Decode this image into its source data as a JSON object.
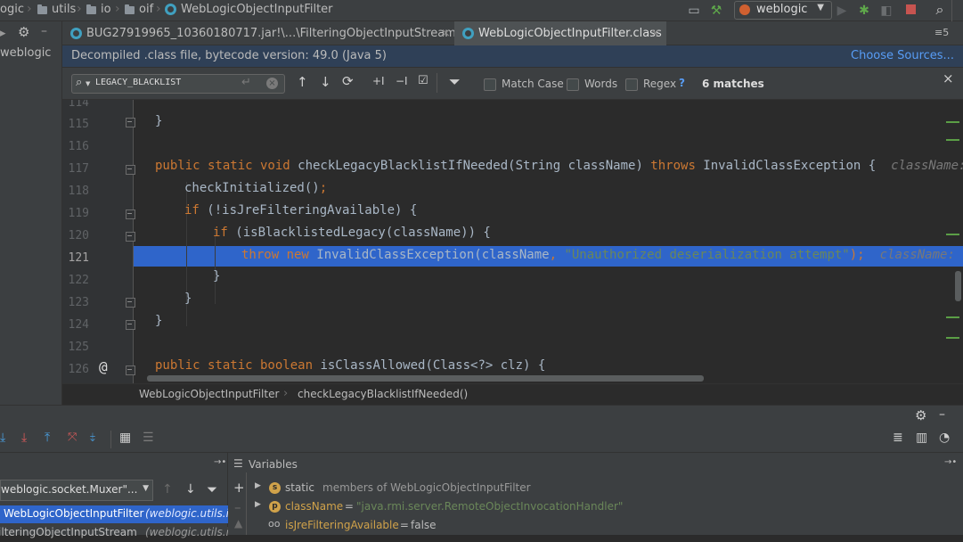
{
  "navbar": {
    "breadcrumbs": [
      "ogic",
      "utils",
      "io",
      "oif",
      "WebLogicObjectInputFilter"
    ],
    "run_config": "weblogic"
  },
  "left_panel": {
    "item": "weblogic"
  },
  "tabs": [
    {
      "label": "BUG27919965_10360180717.jar!\\...\\FilteringObjectInputStream.class",
      "active": false
    },
    {
      "label": "WebLogicObjectInputFilter.class",
      "active": true
    }
  ],
  "tabs_overflow": "≡5",
  "banner": {
    "text": "Decompiled .class file, bytecode version: 49.0 (Java 5)",
    "link": "Choose Sources..."
  },
  "search": {
    "query": "LEGACY_BLACKLIST",
    "options": [
      {
        "label": "Match Case",
        "checked": false
      },
      {
        "label": "Words",
        "checked": false
      },
      {
        "label": "Regex",
        "checked": false
      }
    ],
    "help": "?",
    "matches": "6 matches"
  },
  "editor": {
    "line_numbers": [
      "114",
      "115",
      "116",
      "117",
      "118",
      "119",
      "120",
      "121",
      "122",
      "123",
      "124",
      "125",
      "126"
    ],
    "current_line": "121",
    "code": {
      "l115": "}",
      "l117_kw": "public static void",
      "l117_rest": " checkLegacyBlacklistIfNeeded(String className) ",
      "l117_kw2": "throws",
      "l117_rest2": " InvalidClassException {",
      "l117_hint": "className: \"java",
      "l118": "checkInitialized()",
      "l118_semi": ";",
      "l119_kw": "if",
      "l119_rest": " (!isJreFilteringAvailable) {",
      "l120_kw": "if",
      "l120_rest": " (isBlacklistedLegacy(className)) {",
      "l121_kw": "throw new",
      "l121_rest": " InvalidClassException(className",
      "l121_comma": ", ",
      "l121_str": "\"Unauthorized deserialization attempt\"",
      "l121_end": ");",
      "l121_hint": "className: \"java",
      "l122": "}",
      "l123": "}",
      "l124": "}",
      "l126_kw": "public static boolean",
      "l126_rest": " isClassAllowed(Class<?> clz) {",
      "l126_gutter": "@"
    },
    "breadcrumb": [
      "WebLogicObjectInputFilter",
      "checkLegacyBlacklistIfNeeded()"
    ]
  },
  "debug": {
    "thread_select": "weblogic.socket.Muxer\"...",
    "frames": [
      {
        "method": "WebLogicObjectInputFilter",
        "location": "(weblogic.utils.io",
        "selected": true
      },
      {
        "method": "FilteringObjectInputStream",
        "location": "(weblogic.utils.io",
        "selected": false
      }
    ],
    "variables_title": "Variables",
    "variables": [
      {
        "badge": "s",
        "name": "static",
        "value": "members of WebLogicObjectInputFilter"
      },
      {
        "badge": "p",
        "name": "className",
        "eq": " = ",
        "value": "\"java.rmi.server.RemoteObjectInvocationHandler\""
      },
      {
        "badge": "oo",
        "name": "isJreFilteringAvailable",
        "eq": " = ",
        "value": "false"
      }
    ]
  },
  "colors": {
    "accent": "#2f65ca",
    "keyword": "#cc7832",
    "string": "#6a8759",
    "link": "#589df6",
    "variable_name": "#d0a24a"
  }
}
